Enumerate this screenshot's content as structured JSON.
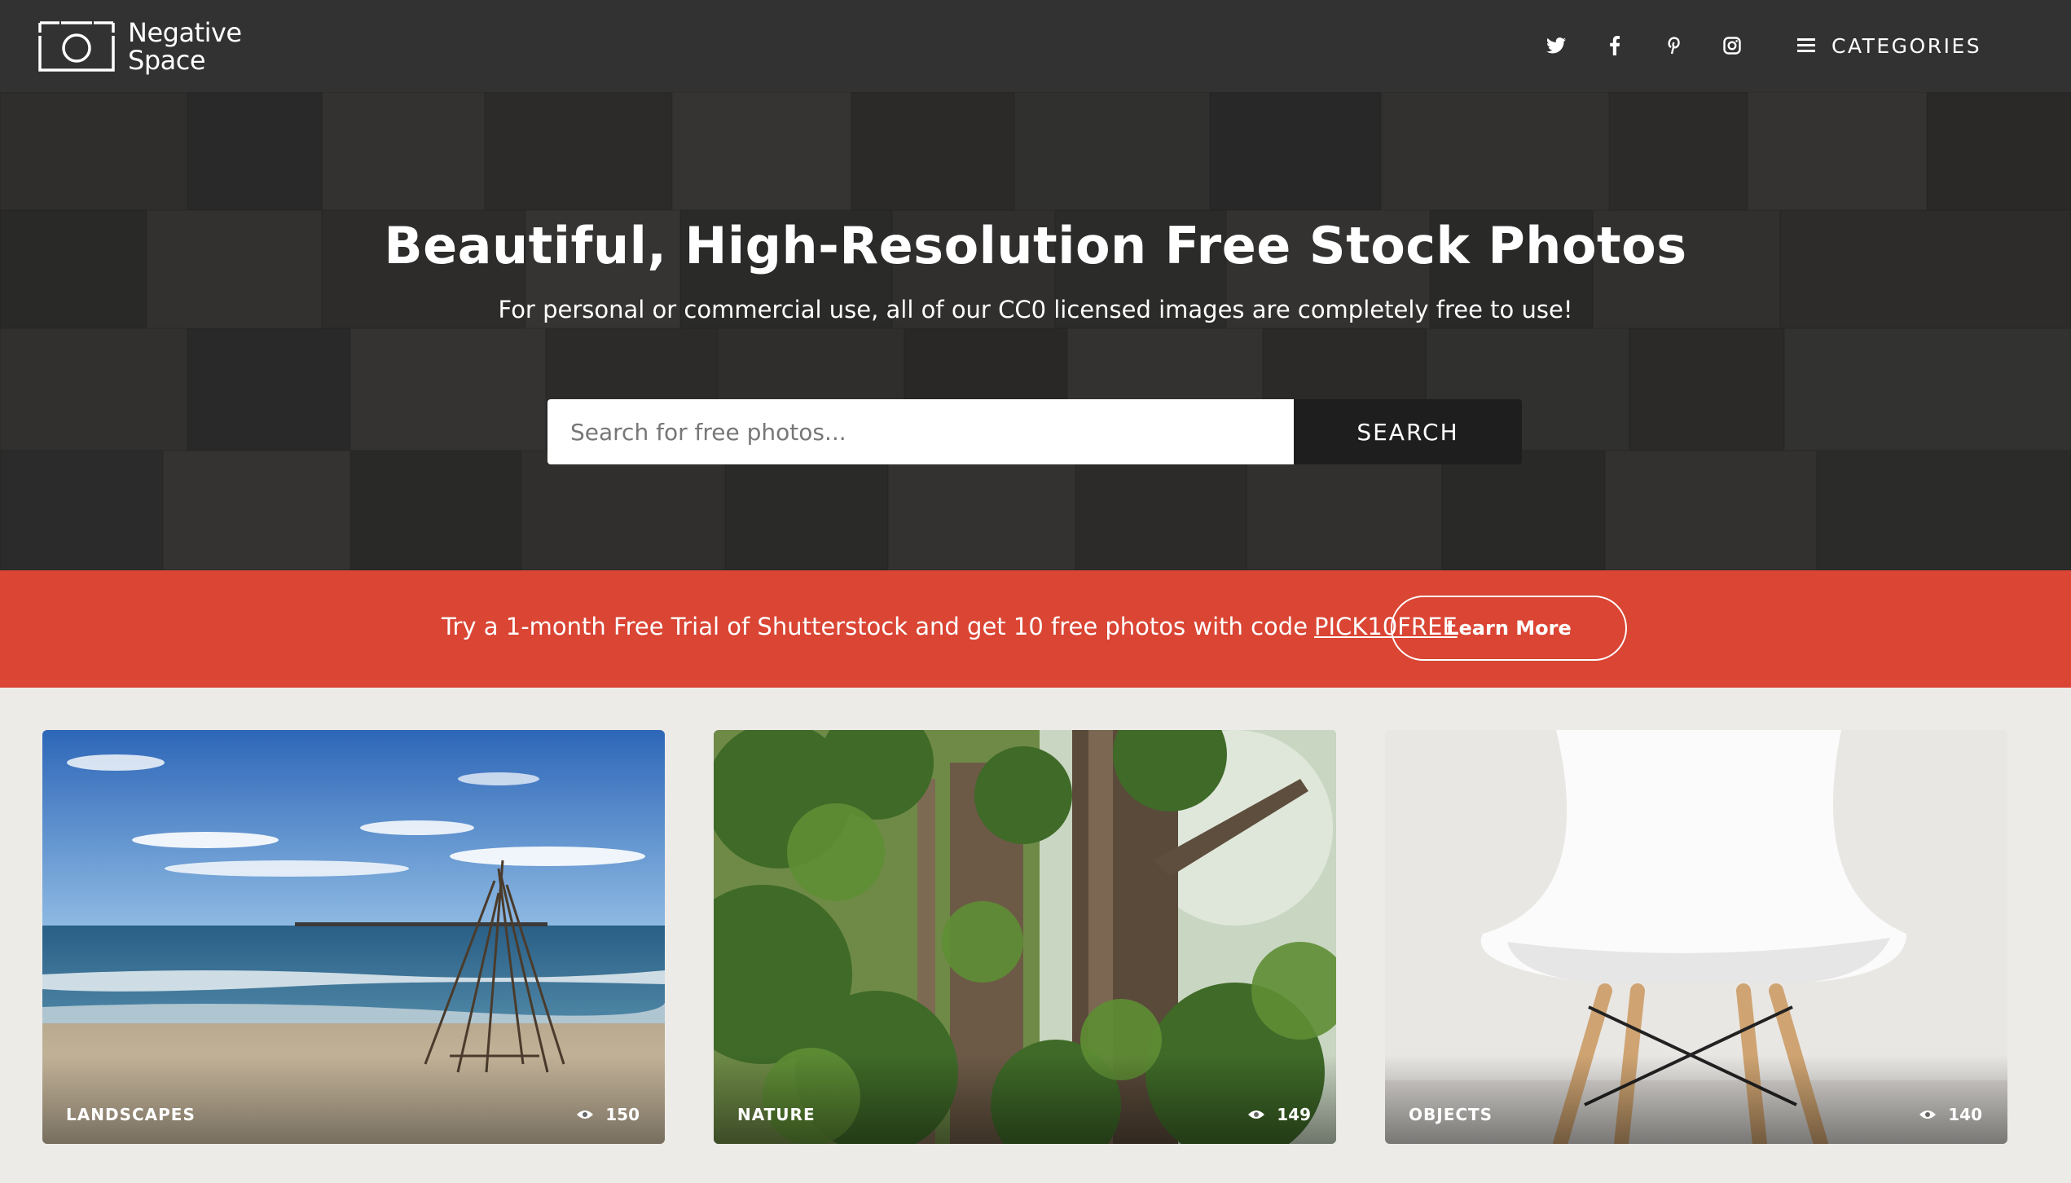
{
  "brand": {
    "name_line1": "Negative",
    "name_line2": "Space"
  },
  "header": {
    "social": [
      "twitter-icon",
      "facebook-icon",
      "pinterest-icon",
      "instagram-icon"
    ],
    "categories_label": "CATEGORIES"
  },
  "hero": {
    "title": "Beautiful, High-Resolution Free Stock Photos",
    "subtitle": "For personal or commercial use, all of our CC0 licensed images are completely free to use!",
    "search_placeholder": "Search for free photos...",
    "search_button": "SEARCH"
  },
  "promo": {
    "text": "Try a 1-month Free Trial of Shutterstock and get 10 free photos with code",
    "code": "PICK10FREE",
    "button": "Learn More",
    "color": "#da4534"
  },
  "cards": [
    {
      "category": "LANDSCAPES",
      "views": "150"
    },
    {
      "category": "NATURE",
      "views": "149"
    },
    {
      "category": "OBJECTS",
      "views": "140"
    }
  ],
  "colors": {
    "topbar": "#323232",
    "page_bg": "#ecebe7",
    "search_button": "#1e1e1e"
  }
}
